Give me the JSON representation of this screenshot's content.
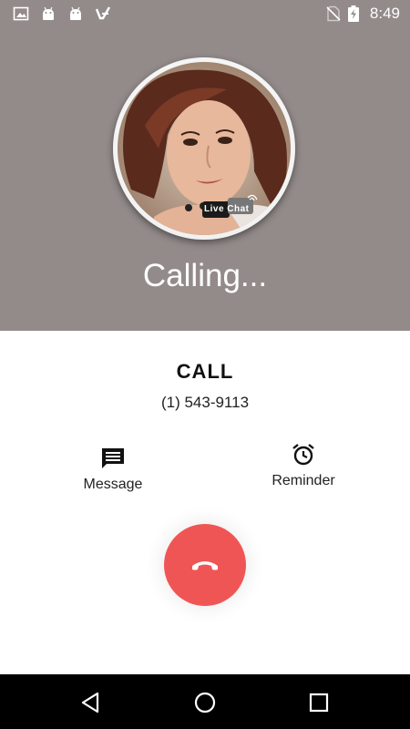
{
  "status_bar": {
    "time": "8:49",
    "left_icons": [
      "image-icon",
      "android-icon",
      "android-icon",
      "check-app-icon"
    ],
    "right_icons": [
      "no-sim-icon",
      "battery-charging-icon"
    ]
  },
  "caller": {
    "avatar_badge": "Live Chat",
    "status": "Calling...",
    "name": "CALL",
    "number": "(1) 543-9113"
  },
  "actions": {
    "message_label": "Message",
    "reminder_label": "Reminder"
  },
  "nav": [
    "back-icon",
    "home-icon",
    "recents-icon"
  ],
  "colors": {
    "top_background": "#938b8a",
    "hangup": "#f05555",
    "nav_background": "#000000"
  }
}
